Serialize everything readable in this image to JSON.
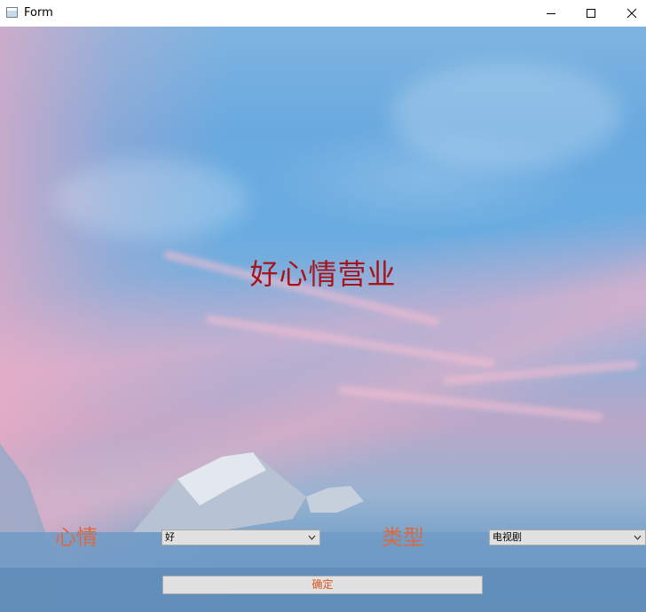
{
  "window": {
    "title": "Form",
    "icons": {
      "app": "app-window-icon",
      "minimize": "minimize-icon",
      "maximize": "maximize-icon",
      "close": "close-icon"
    }
  },
  "main": {
    "title": "好心情营业",
    "mood": {
      "label": "心情",
      "selected": "好"
    },
    "type": {
      "label": "类型",
      "selected": "电视剧"
    },
    "confirm_label": "确定"
  },
  "colors": {
    "title_text": "#a5141c",
    "label_text": "#d96a45",
    "button_text": "#d9541e",
    "control_bg": "#e1e1e1"
  }
}
